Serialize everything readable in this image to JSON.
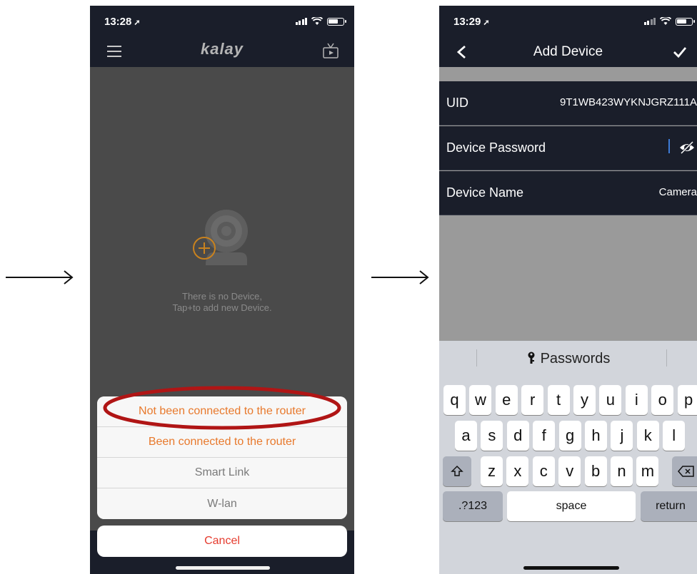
{
  "screen1": {
    "status_time": "13:28",
    "logo": "kalay",
    "empty_line1": "There is no Device,",
    "empty_line2": "Tap+to add new Device.",
    "options": [
      {
        "label": "Not been connected to the router",
        "style": "orange"
      },
      {
        "label": "Been connected to the router",
        "style": "orange"
      },
      {
        "label": "Smart Link",
        "style": "gray"
      },
      {
        "label": "W-lan",
        "style": "gray"
      }
    ],
    "cancel_label": "Cancel"
  },
  "screen2": {
    "status_time": "13:29",
    "title": "Add Device",
    "fields": [
      {
        "label": "UID",
        "value": "9T1WB423WYKNJGRZ111A"
      },
      {
        "label": "Device Password",
        "value": ""
      },
      {
        "label": "Device Name",
        "value": "Camera"
      }
    ],
    "keyboard": {
      "suggestion": "Passwords",
      "row1": [
        "q",
        "w",
        "e",
        "r",
        "t",
        "y",
        "u",
        "i",
        "o",
        "p"
      ],
      "row2": [
        "a",
        "s",
        "d",
        "f",
        "g",
        "h",
        "j",
        "k",
        "l"
      ],
      "row3": [
        "z",
        "x",
        "c",
        "v",
        "b",
        "n",
        "m"
      ],
      "numbers_label": ".?123",
      "space_label": "space",
      "return_label": "return"
    }
  },
  "colors": {
    "nav_dark": "#1a1e2a",
    "orange": "#e8792c",
    "cancel_red": "#e53b2e",
    "annotation_red": "#b01515"
  }
}
